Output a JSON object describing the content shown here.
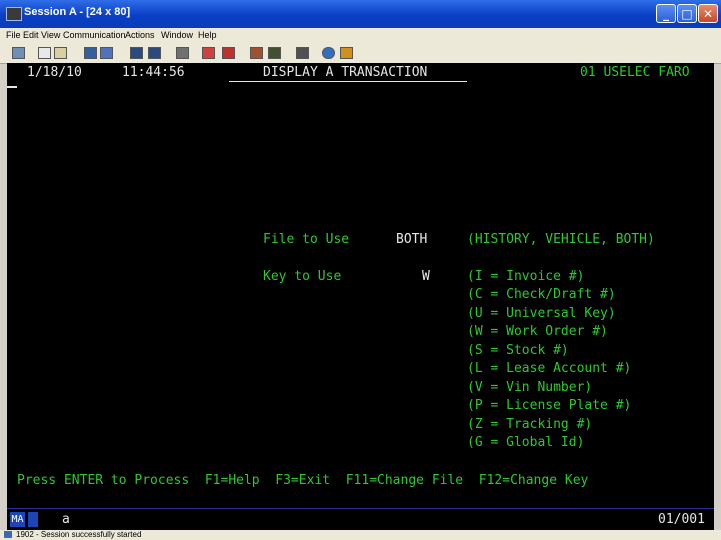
{
  "window": {
    "title": "Session A - [24 x 80]"
  },
  "menu": [
    "File",
    "Edit",
    "View",
    "Communication",
    "Actions",
    "Window",
    "Help"
  ],
  "toolbar": {
    "icons": [
      "print-screen-icon",
      "copy-icon",
      "paste-icon",
      "send-icon",
      "receive-icon",
      "display-icon",
      "keyboard-icon",
      "chart-icon",
      "macro-record-icon",
      "macro-stop-icon",
      "macro-play-icon",
      "customize-icon",
      "help-icon",
      "color-icon",
      "keypad-icon"
    ]
  },
  "screen": {
    "date": "1/18/10",
    "time": "11:44:56",
    "title": "DISPLAY A TRANSACTION",
    "code": "01 USELEC FARO",
    "file_label": "File to Use",
    "file_value": "BOTH",
    "file_options": "(HISTORY, VEHICLE, BOTH)",
    "key_label": "Key to Use",
    "key_value": "W",
    "key_options": [
      "(I = Invoice #)",
      "(C = Check/Draft #)",
      "(U = Universal Key)",
      "(W = Work Order #)",
      "(S = Stock #)",
      "(L = Lease Account #)",
      "(V = Vin Number)",
      "(P = License Plate #)",
      "(Z = Tracking #)",
      "(G = Global Id)"
    ],
    "fkeys": "Press ENTER to Process  F1=Help  F3=Exit  F11=Change File  F12=Change Key"
  },
  "oia": {
    "indicator": "MA",
    "input": "a",
    "position": "01/001"
  },
  "status": "1902 - Session successfully started"
}
